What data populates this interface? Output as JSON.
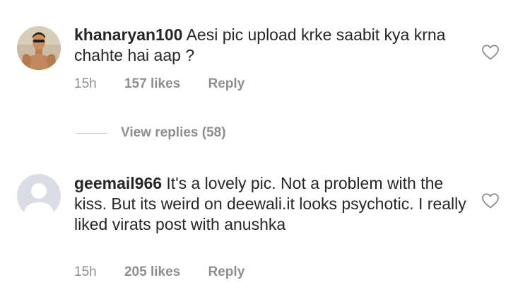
{
  "comments": [
    {
      "username": "khanaryan100",
      "text": "Aesi pic upload krke saabit kya krna chahte hai aap ?",
      "time": "15h",
      "likes": "157 likes",
      "reply": "Reply",
      "avatar": "user-photo",
      "like_icon": "heart-outline-icon"
    },
    {
      "username": "geemail966",
      "text": "It's a lovely pic. Not a problem with the kiss. But its weird on deewali.it looks psychotic. I really liked virats post with anushka",
      "time": "15h",
      "likes": "205 likes",
      "reply": "Reply",
      "avatar": "default-avatar-placeholder",
      "like_icon": "heart-outline-icon"
    }
  ],
  "view_replies": {
    "label": "View replies (58)"
  },
  "colors": {
    "text": "#262626",
    "secondary": "#8e8e8e",
    "divider": "#c7c7c7",
    "placeholder_bg": "#dbdde6",
    "placeholder_fg": "#ffffff"
  }
}
